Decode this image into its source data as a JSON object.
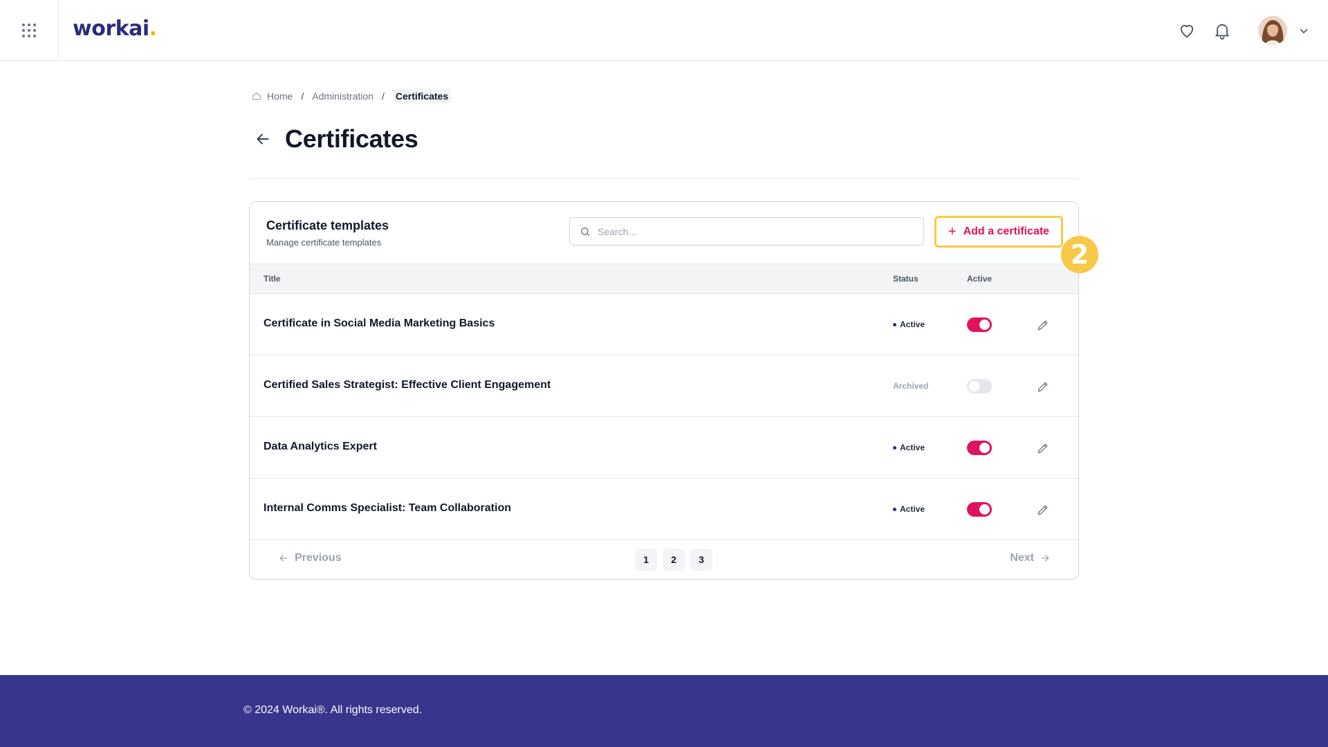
{
  "header": {
    "logo_text": "workai",
    "logo_dot": ".",
    "icons": [
      "apps-grid-icon",
      "heart-icon",
      "bell-icon",
      "chevron-down-icon"
    ]
  },
  "breadcrumb": {
    "home": "Home",
    "admin": "Administration",
    "current": "Certificates",
    "separator": "/"
  },
  "page": {
    "title": "Certificates"
  },
  "card": {
    "title": "Certificate templates",
    "subtitle": "Manage certificate templates",
    "search_placeholder": "Search...",
    "add_button": "Add a certificate",
    "add_icon": "+"
  },
  "table": {
    "columns": {
      "title": "Title",
      "status": "Status",
      "active": "Active"
    },
    "rows": [
      {
        "title": "Certificate in Social Media Marketing Basics",
        "status": "Active",
        "active": true
      },
      {
        "title": "Certified Sales Strategist: Effective Client Engagement",
        "status": "Archived",
        "active": false
      },
      {
        "title": "Data Analytics Expert",
        "status": "Active",
        "active": true
      },
      {
        "title": "Internal Comms Specialist: Team Collaboration",
        "status": "Active",
        "active": true
      }
    ]
  },
  "pagination": {
    "previous": "Previous",
    "next": "Next",
    "pages": [
      "1",
      "2",
      "3"
    ]
  },
  "annotation": {
    "step": "2"
  },
  "footer": {
    "copyright": "© 2024 Workai®. All rights reserved."
  },
  "colors": {
    "brand": "#2d2b7c",
    "accent": "#e0115f",
    "highlight": "#f7c948",
    "footer": "#38358c"
  }
}
